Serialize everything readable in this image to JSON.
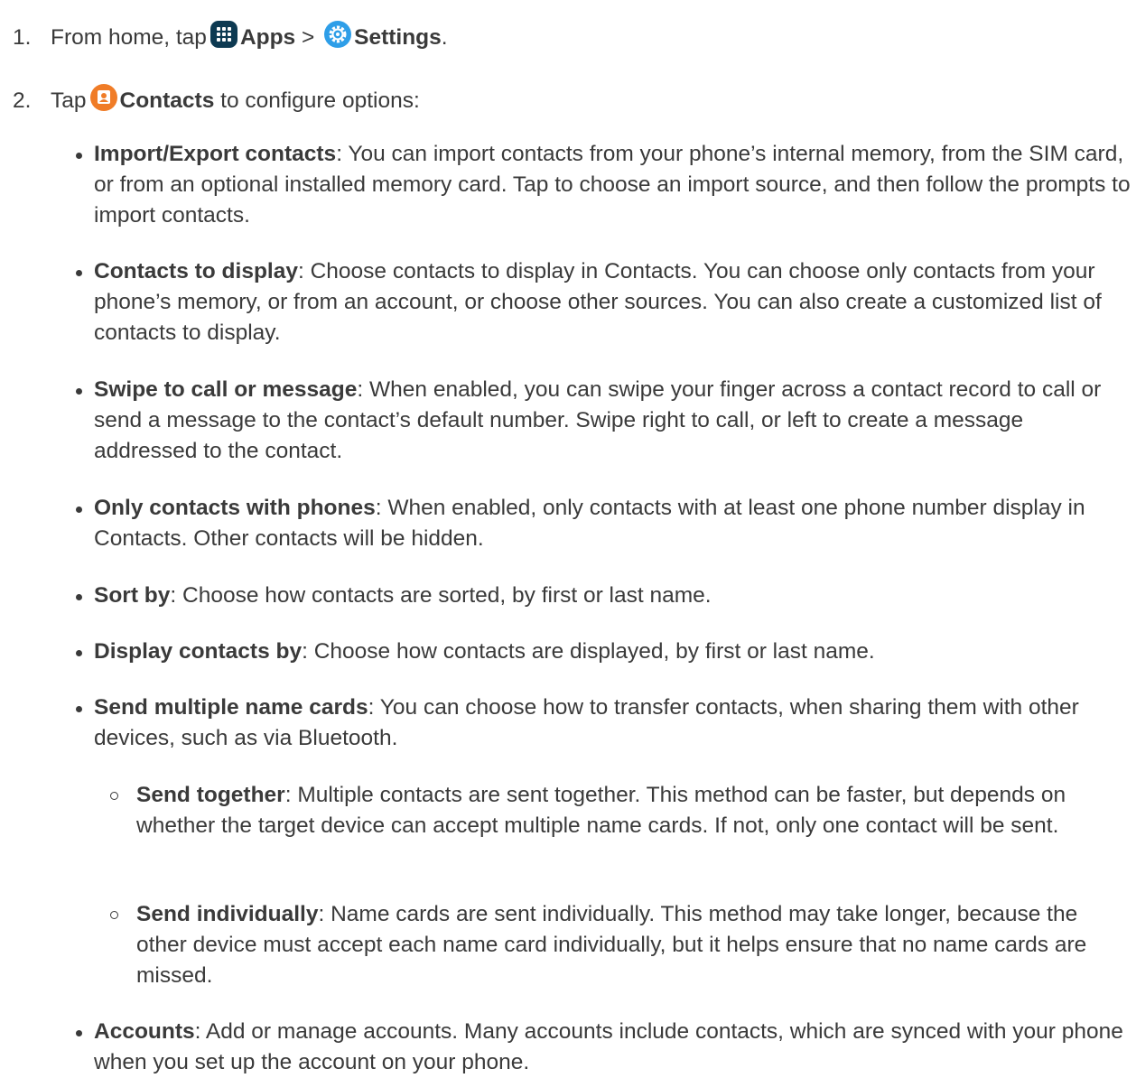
{
  "steps": [
    {
      "number": "1.",
      "text_before": "From home, tap",
      "icon1_name": "apps-icon",
      "label1": "Apps",
      "separator": ">",
      "icon2_name": "settings-icon",
      "label2": "Settings",
      "text_after": "."
    },
    {
      "number": "2.",
      "text_before": "Tap",
      "icon_name": "contacts-icon",
      "label": "Contacts",
      "text_after": "to configure options:"
    }
  ],
  "colors": {
    "text": "#3a3a3a",
    "apps_icon_bg": "#0d3a52",
    "settings_icon_bg": "#2e9ee8",
    "contacts_icon_bg": "#f07c27"
  },
  "options": [
    {
      "term": "Import/Export contacts",
      "description": "You can import contacts from your phone’s internal memory, from the SIM card, or from an optional installed memory card. Tap to choose an import source, and then follow the prompts to import contacts."
    },
    {
      "term": "Contacts to display",
      "description": "Choose contacts to display in Contacts. You can choose only contacts from your phone’s memory, or from an account, or choose other sources. You can also create a customized list of contacts to display."
    },
    {
      "term": "Swipe to call or message",
      "description": "When enabled, you can swipe your finger across a contact record to call or send a message to the contact’s default number. Swipe right to call, or left to create a message addressed to the contact."
    },
    {
      "term": "Only contacts with phones",
      "description": "When enabled, only contacts with at least one phone number display in Contacts. Other contacts will be hidden."
    },
    {
      "term": "Sort by",
      "description": "Choose how contacts are sorted, by first or last name."
    },
    {
      "term": "Display contacts by",
      "description": "Choose how contacts are displayed, by first or last name."
    },
    {
      "term": "Send multiple name cards",
      "description": "You can choose how to transfer contacts, when sharing them with other devices, such as via Bluetooth.",
      "sub_options": [
        {
          "term": "Send together",
          "description": "Multiple contacts are sent together. This method can be faster, but depends on whether the target device can accept multiple name cards. If not, only one contact will be sent."
        },
        {
          "term": "Send individually",
          "description": "Name cards are sent individually. This method may take longer, because the other device must accept each name card individually, but it helps ensure that no name cards are missed."
        }
      ]
    },
    {
      "term": "Accounts",
      "description": "Add or manage accounts. Many accounts include contacts, which are synced with your phone when you set up the account on your phone."
    }
  ]
}
